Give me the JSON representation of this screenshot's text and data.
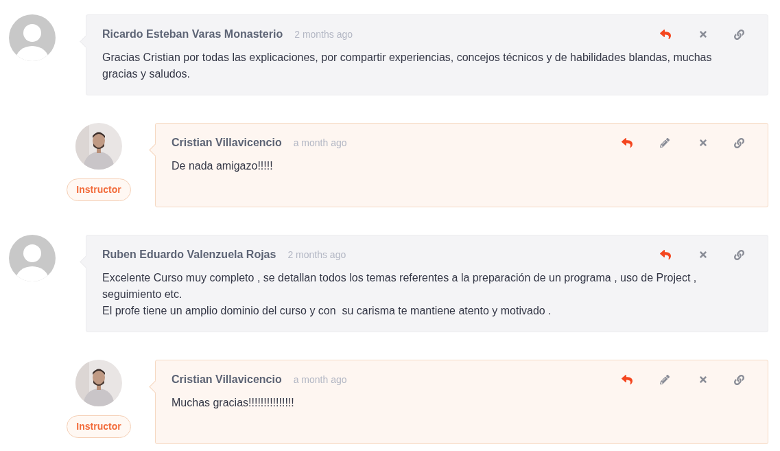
{
  "comments": [
    {
      "kind": "student",
      "author": "Ricardo Esteban Varas Monasterio",
      "time": "2 months ago",
      "can_edit": false,
      "body": [
        "Gracias Cristian por todas las explicaciones, por compartir experiencias, concejos técnicos y de habilidades blandas, muchas gracias y saludos."
      ]
    },
    {
      "kind": "instructor",
      "badge": "Instructor",
      "author": "Cristian Villavicencio",
      "time": "a month ago",
      "can_edit": true,
      "body": [
        "De nada amigazo!!!!!"
      ]
    },
    {
      "kind": "student",
      "author": "Ruben Eduardo Valenzuela Rojas",
      "time": "2 months ago",
      "can_edit": false,
      "body": [
        "Excelente Curso muy completo , se detallan todos los temas referentes a la preparación de un programa , uso de Project , seguimiento etc.",
        "El profe tiene un amplio dominio del curso y con  su carisma te mantiene atento y motivado ."
      ]
    },
    {
      "kind": "instructor",
      "badge": "Instructor",
      "author": "Cristian Villavicencio",
      "time": "a month ago",
      "can_edit": true,
      "body": [
        "Muchas gracias!!!!!!!!!!!!!!!"
      ]
    }
  ]
}
